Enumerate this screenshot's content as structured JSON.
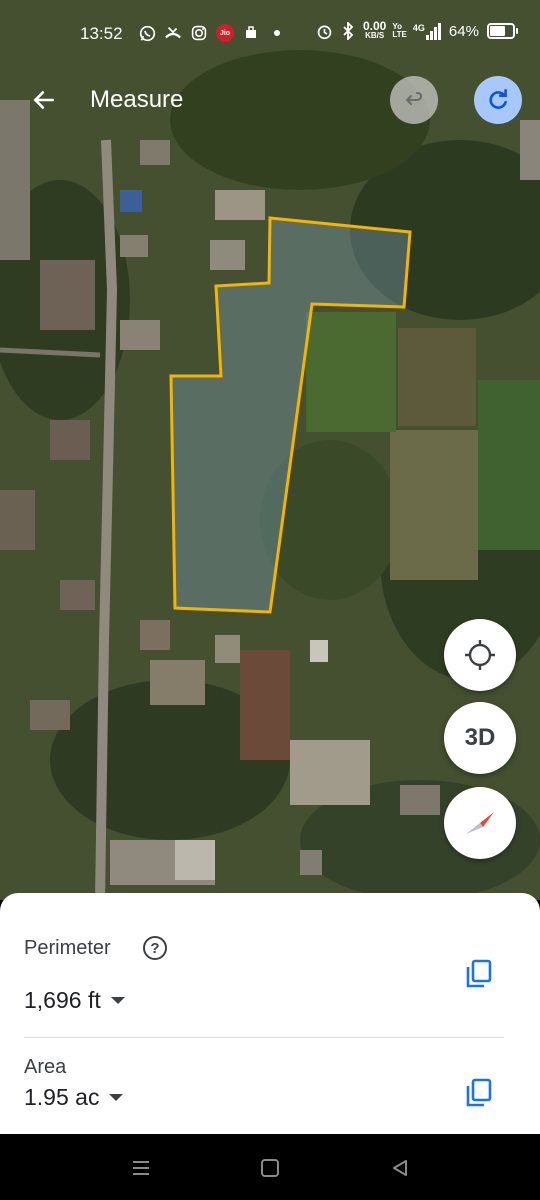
{
  "status_bar": {
    "time": "13:52",
    "carrier_badge": "Jio",
    "net_speed_value": "0.00",
    "net_speed_unit": "KB/S",
    "volte_top": "Yo",
    "volte_bottom": "LTE",
    "network_type": "4G",
    "battery_percent": "64%",
    "battery_level": 0.64
  },
  "header": {
    "title": "Measure",
    "back_icon": "arrow-back-icon",
    "undo_icon": "undo-icon",
    "redo_icon": "redo-icon"
  },
  "map_controls": {
    "locate_icon": "my-location-icon",
    "three_d_label": "3D",
    "compass_icon": "compass-icon"
  },
  "measurement": {
    "perimeter_label": "Perimeter",
    "help_glyph": "?",
    "perimeter_value": "1,696 ft",
    "area_label": "Area",
    "area_value": "1.95 ac",
    "copy_icon": "copy-icon",
    "outline_color": "#f4b400"
  },
  "nav_bar": {
    "recents_icon": "recents-icon",
    "home_icon": "home-icon",
    "back_icon": "nav-back-icon"
  }
}
